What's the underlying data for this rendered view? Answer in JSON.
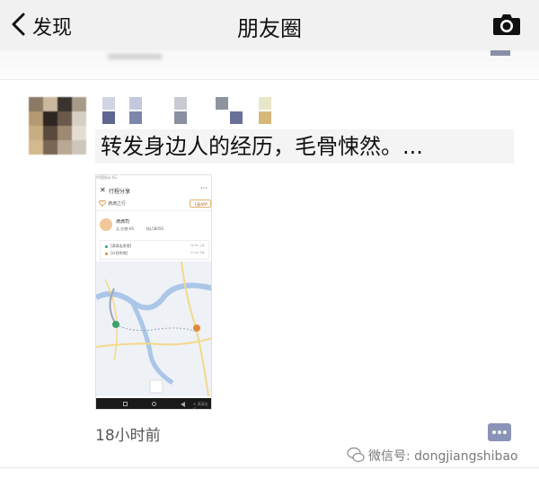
{
  "nav": {
    "back_label": "发现",
    "title": "朋友圈"
  },
  "post": {
    "text": "转发身边人的经历，毛骨悚然。...",
    "time": "18小时前"
  },
  "shared_screenshot": {
    "status_text": "中国移动 4G",
    "status_right": "17%",
    "title": "行程分享",
    "more_label": "···",
    "trip_label": "滴滴之行",
    "download_label": "下载APP",
    "driver_name": "滴滴司",
    "driver_car": "吉  红旗·H5",
    "driver_plate": "桂L58056",
    "start_address": "[滴滴出发地]",
    "end_address": "[众目的地]",
    "start_time": "06:55 上车",
    "end_time": "07:06 下车",
    "watermark": "⊙ 滴滴出行"
  },
  "footer": {
    "wechat_id": "微信号: dongjiangshibao"
  },
  "colors": {
    "nav_bg": "#f1f1f1",
    "text_bg": "#f4f4f4",
    "accent_green": "#3aa36b",
    "accent_orange": "#e08a3a"
  },
  "icons": [
    "chevron-left-icon",
    "camera-icon",
    "heart-icon",
    "comment-icon",
    "wechat-logo-icon"
  ]
}
